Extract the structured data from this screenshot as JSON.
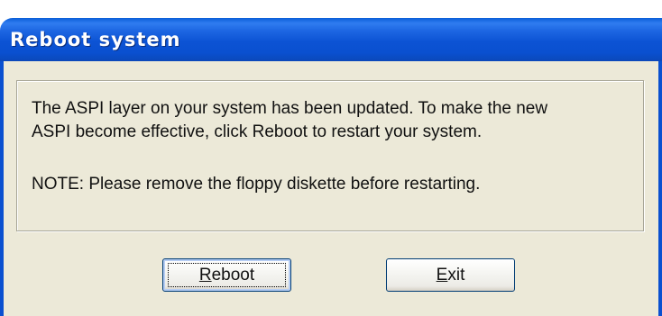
{
  "window": {
    "title": "Reboot system"
  },
  "message": {
    "line1": "The ASPI layer on your system has been updated. To make the new",
    "line2": "ASPI become effective, click Reboot to restart your system.",
    "note": "NOTE: Please remove the floppy diskette before restarting."
  },
  "buttons": {
    "reboot": {
      "mnemonic": "R",
      "rest": "eboot"
    },
    "exit": {
      "mnemonic": "E",
      "rest": "xit"
    }
  },
  "colors": {
    "titlebar": "#0a50d0",
    "dialog_face": "#ece9d8",
    "button_border": "#003c74"
  }
}
